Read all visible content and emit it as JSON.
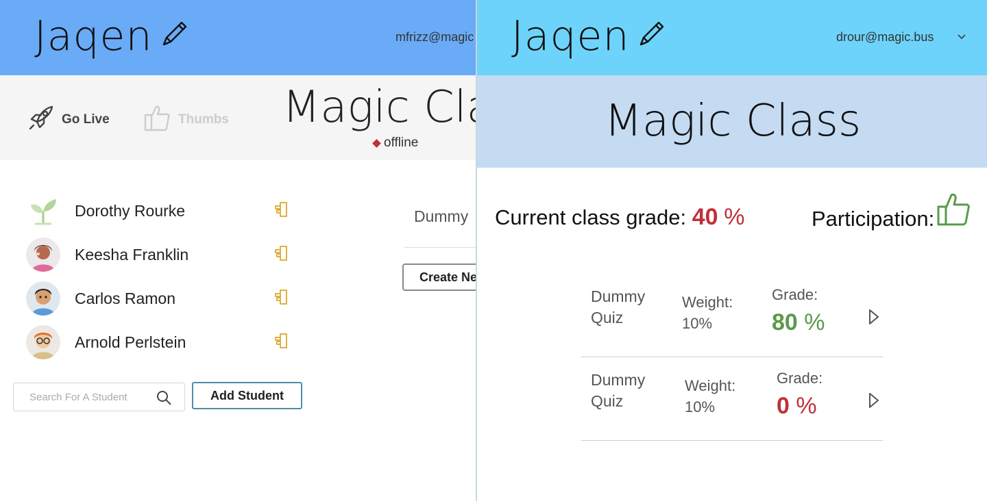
{
  "teacher": {
    "app_title": "Jaqen",
    "user_email": "mfrizz@magic",
    "actions": {
      "go_live": "Go Live",
      "thumbs": "Thumbs"
    },
    "class_title": "Magic Cla",
    "status": "offline",
    "students": [
      {
        "name": "Dorothy Rourke",
        "avatar": "sprout-icon"
      },
      {
        "name": "Keesha Franklin",
        "avatar": "avatar-keesha"
      },
      {
        "name": "Carlos Ramon",
        "avatar": "avatar-carlos"
      },
      {
        "name": "Arnold Perlstein",
        "avatar": "avatar-arnold"
      }
    ],
    "search": {
      "placeholder": "Search For A Student",
      "value": ""
    },
    "add_student_label": "Add Student",
    "quiz_name": "Dummy",
    "create_new_label": "Create Ne"
  },
  "student": {
    "app_title": "Jaqen",
    "user_email": "drour@magic.bus",
    "class_title": "Magic Class",
    "current_grade": {
      "label": "Current class grade:",
      "value": "40",
      "unit": "%"
    },
    "participation_label": "Participation:",
    "quizzes": [
      {
        "name": "Dummy Quiz",
        "weight_label": "Weight:",
        "weight": "10%",
        "grade_label": "Grade:",
        "grade": "80",
        "unit": "%",
        "grade_color": "#5a9a4a"
      },
      {
        "name": "Dummy Quiz",
        "weight_label": "Weight:",
        "weight": "10%",
        "grade_label": "Grade:",
        "grade": "0",
        "unit": "%",
        "grade_color": "#c0303a"
      }
    ]
  },
  "colors": {
    "teacher_header": "#6aabf7",
    "student_header": "#6dd3fb",
    "student_subheader": "#c4dbf2",
    "accent_red": "#c0303a",
    "accent_green": "#5a9a4a",
    "hand_icon": "#e0b040"
  }
}
